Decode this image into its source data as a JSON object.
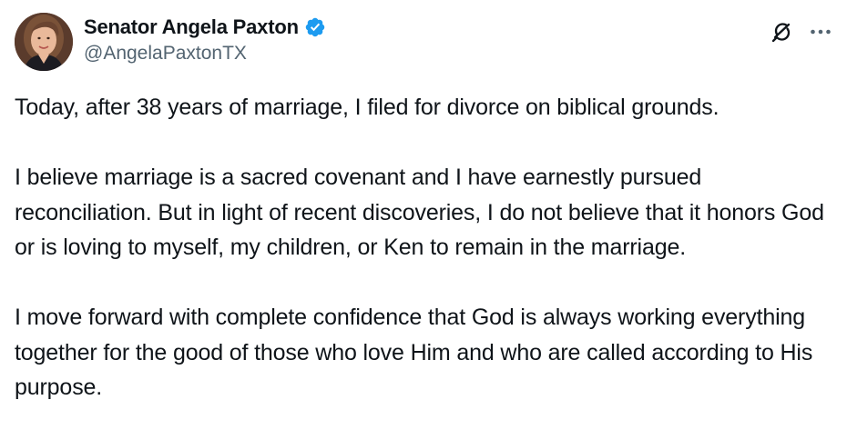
{
  "author": {
    "display_name": "Senator Angela Paxton",
    "handle": "@AngelaPaxtonTX",
    "verified": true
  },
  "icons": {
    "verified": "verified-badge-icon",
    "grok": "grok-icon",
    "more": "more-horizontal-icon"
  },
  "colors": {
    "verified_blue": "#1d9bf0",
    "text_primary": "#0f1419",
    "text_secondary": "#536471"
  },
  "tweet": {
    "paragraphs": [
      "Today, after 38 years of marriage, I filed for divorce on biblical grounds.",
      "I believe marriage is a sacred covenant and I have earnestly pursued reconciliation. But in light of recent discoveries, I do not believe that it honors God or is loving to myself, my children, or Ken to remain in the marriage.",
      "I move forward with complete confidence that God is always working everything together for the good of those who love Him and who are called according to His purpose."
    ]
  }
}
